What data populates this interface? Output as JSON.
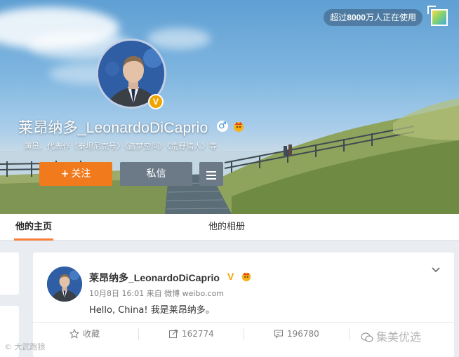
{
  "cover": {
    "usage_badge_prefix": "超过",
    "usage_badge_count": "8000",
    "usage_badge_suffix": "万人正在使用",
    "skin_icon": "skin-template-icon"
  },
  "profile": {
    "name": "莱昂纳多_LeonardoDiCaprio",
    "gender_symbol": "♂",
    "verify_symbol": "V",
    "intro": "演员，代表作《泰坦尼克号》《盗梦空间》《荒野猎人》等",
    "follow_plus": "+",
    "follow_label": "关注",
    "message_label": "私信",
    "more_icon": "menu-icon"
  },
  "tabs": [
    {
      "label": "他的主页"
    },
    {
      "label": "他的相册"
    }
  ],
  "feed": {
    "author": "莱昂纳多_LeonardoDiCaprio",
    "verify_symbol": "V",
    "meta": "10月8日 16:01 来自 微博 weibo.com",
    "text": "Hello, China! 我是莱昂纳多。",
    "actions": {
      "favorite_label": "收藏",
      "repost_count": "162774",
      "comment_count": "196780",
      "like_count": "..."
    }
  },
  "watermarks": {
    "left": "© 大武跑狼",
    "right": "集美优选"
  },
  "colors": {
    "follow_orange": "#f07a1c",
    "tab_active": "#fa7d3c",
    "verify_gold": "#f0a400"
  }
}
